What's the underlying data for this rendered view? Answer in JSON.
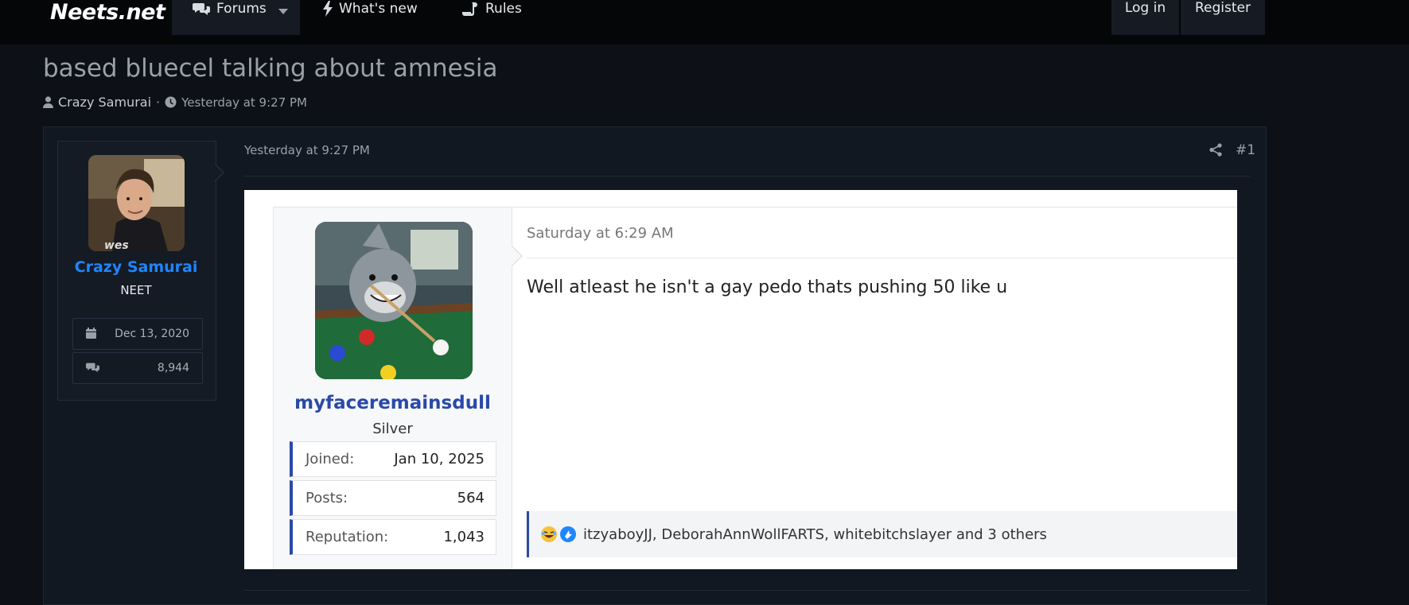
{
  "nav": {
    "logo": "Neets.net",
    "forums": "Forums",
    "whats_new": "What's new",
    "rules": "Rules",
    "login": "Log in",
    "register": "Register"
  },
  "thread": {
    "title": "based bluecel talking about amnesia",
    "author": "Crazy Samurai",
    "separator": "·",
    "time": "Yesterday at 9:27 PM"
  },
  "post": {
    "date": "Yesterday at 9:27 PM",
    "number": "#1",
    "user": {
      "name": "Crazy Samurai",
      "title": "NEET",
      "joined": "Dec 13, 2020",
      "messages": "8,944"
    },
    "embed": {
      "username": "myfaceremainsdull",
      "user_title": "Silver",
      "rows": [
        {
          "k": "Joined:",
          "v": "Jan 10, 2025"
        },
        {
          "k": "Posts:",
          "v": "564"
        },
        {
          "k": "Reputation:",
          "v": "1,043"
        }
      ],
      "date": "Saturday at 6:29 AM",
      "message": "Well atleast he isn't a gay pedo thats pushing 50 like u",
      "reactions": "itzyaboyJJ, DeborahAnnWollFARTS, whitebitchslayer and 3 others"
    }
  },
  "colors": {
    "accent": "#1f86ff",
    "background": "#0d1016",
    "embed_link": "#2a49a8"
  }
}
